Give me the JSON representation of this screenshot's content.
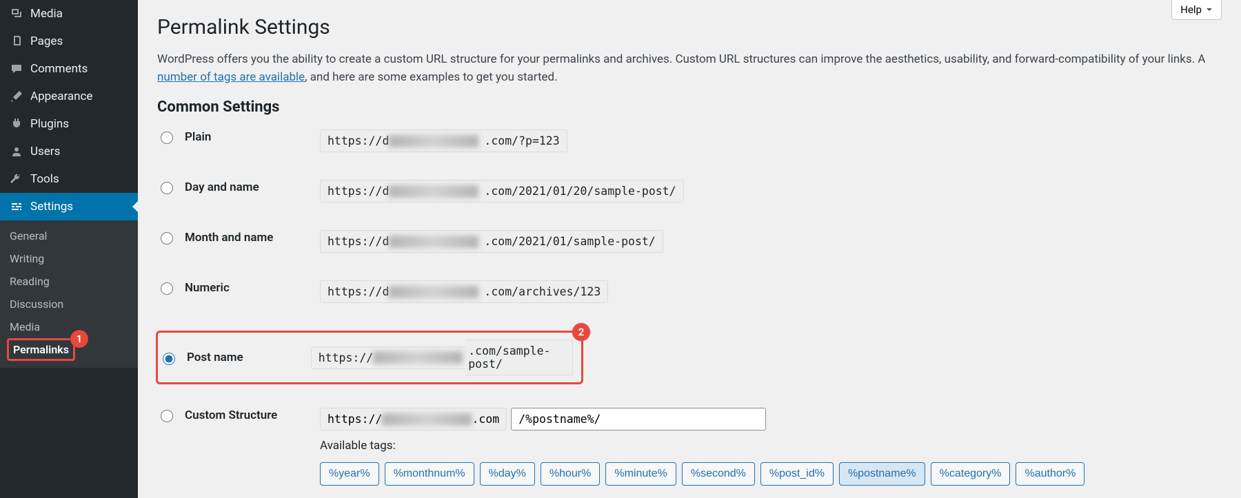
{
  "sidebar": {
    "items": [
      {
        "label": "Media"
      },
      {
        "label": "Pages"
      },
      {
        "label": "Comments"
      },
      {
        "label": "Appearance"
      },
      {
        "label": "Plugins"
      },
      {
        "label": "Users"
      },
      {
        "label": "Tools"
      },
      {
        "label": "Settings"
      }
    ],
    "submenu": {
      "general": "General",
      "writing": "Writing",
      "reading": "Reading",
      "discussion": "Discussion",
      "media": "Media",
      "permalinks": "Permalinks"
    }
  },
  "help_label": "Help",
  "page_title": "Permalink Settings",
  "intro_part1": "WordPress offers you the ability to create a custom URL structure for your permalinks and archives. Custom URL structures can improve the aesthetics, usability, and forward-compatibility of your links. A ",
  "intro_link": "number of tags are available",
  "intro_part2": ", and here are some examples to get you started.",
  "section_title": "Common Settings",
  "options": {
    "plain": {
      "label": "Plain",
      "prefix": "https://d",
      "suffix": ".com/?p=123"
    },
    "dayname": {
      "label": "Day and name",
      "prefix": "https://d",
      "suffix": ".com/2021/01/20/sample-post/"
    },
    "monthname": {
      "label": "Month and name",
      "prefix": "https://d",
      "suffix": ".com/2021/01/sample-post/"
    },
    "numeric": {
      "label": "Numeric",
      "prefix": "https://d",
      "suffix": ".com/archives/123"
    },
    "postname": {
      "label": "Post name",
      "prefix": "https://",
      "suffix": ".com/sample-post/"
    },
    "custom": {
      "label": "Custom Structure",
      "prefix": "https://",
      "suffix": ".com",
      "value": "/%postname%/"
    }
  },
  "tags_label": "Available tags:",
  "tags": [
    "%year%",
    "%monthnum%",
    "%day%",
    "%hour%",
    "%minute%",
    "%second%",
    "%post_id%",
    "%postname%",
    "%category%",
    "%author%"
  ],
  "annotations": {
    "permalinks": "1",
    "postname": "2"
  }
}
